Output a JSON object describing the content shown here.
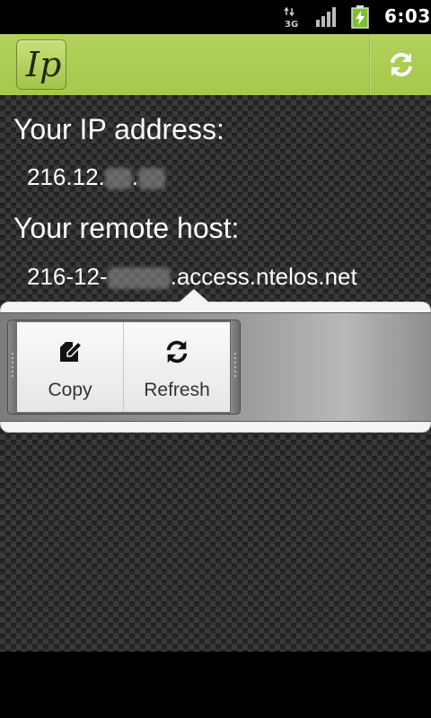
{
  "status_bar": {
    "network": "3G",
    "time": "6:03",
    "icons": [
      "3g-data-icon",
      "signal-bars-icon",
      "battery-charging-icon"
    ]
  },
  "action_bar": {
    "logo_text": "Ip",
    "action_icon": "refresh-icon",
    "accent": "#a6c84c"
  },
  "content": {
    "ip_label": "Your IP address:",
    "ip_value_prefix": "216.12.",
    "ip_value_sep": ".",
    "host_label": "Your remote host:",
    "host_value_prefix": "216-12-",
    "host_value_suffix": ".access.ntelos.net"
  },
  "quick_actions": {
    "items": [
      {
        "label": "Copy",
        "icon": "copy-edit-icon"
      },
      {
        "label": "Refresh",
        "icon": "refresh-icon"
      }
    ]
  }
}
